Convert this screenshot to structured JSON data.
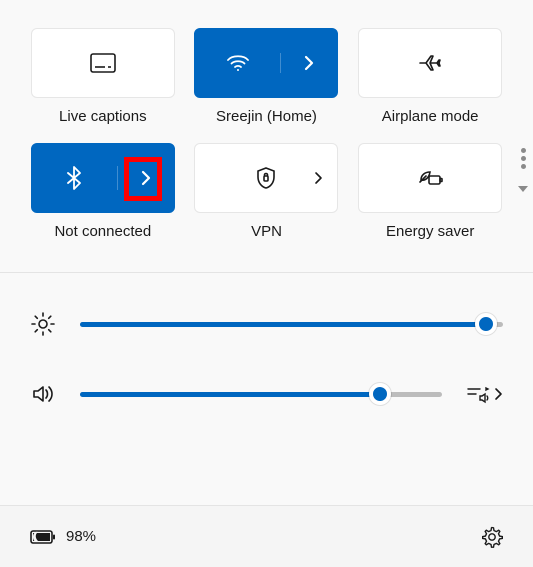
{
  "tiles": {
    "live_captions": {
      "label": "Live captions"
    },
    "wifi": {
      "label": "Sreejin (Home)"
    },
    "airplane": {
      "label": "Airplane mode"
    },
    "bluetooth": {
      "label": "Not connected"
    },
    "vpn": {
      "label": "VPN"
    },
    "energy": {
      "label": "Energy saver"
    }
  },
  "sliders": {
    "brightness": {
      "value": 96
    },
    "volume": {
      "value": 83
    }
  },
  "battery": {
    "percent": "98%"
  },
  "colors": {
    "accent": "#0067c0"
  }
}
